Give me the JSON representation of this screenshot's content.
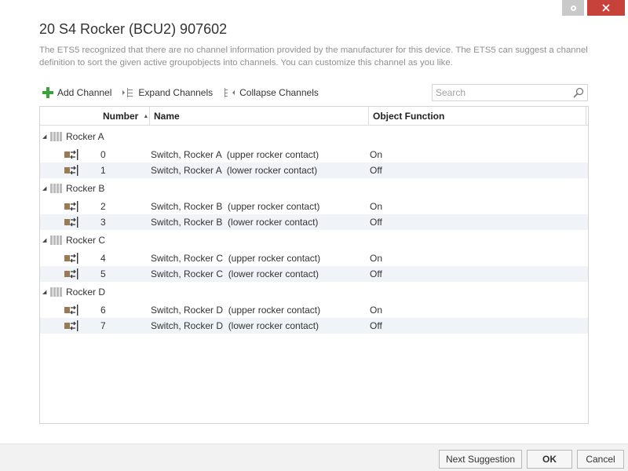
{
  "dialog": {
    "title": "20 S4 Rocker (BCU2)  907602",
    "description": "The ETS5 recognized that there are no channel information provided by the manufacturer for this device. The ETS5 can suggest a channel definition to sort the given active groupobjects into channels. You can customize this channel as you like."
  },
  "toolbar": {
    "add_channel": "Add Channel",
    "expand_channels": "Expand Channels",
    "collapse_channels": "Collapse Channels",
    "search_placeholder": "Search"
  },
  "grid": {
    "columns": {
      "number": "Number",
      "name": "Name",
      "object_function": "Object Function"
    },
    "groups": [
      {
        "label": "Rocker A",
        "rows": [
          {
            "number": "0",
            "name": "Switch, Rocker A  (upper rocker contact)",
            "function": "On"
          },
          {
            "number": "1",
            "name": "Switch, Rocker A  (lower rocker contact)",
            "function": "Off"
          }
        ]
      },
      {
        "label": "Rocker B",
        "rows": [
          {
            "number": "2",
            "name": "Switch, Rocker B  (upper rocker contact)",
            "function": "On"
          },
          {
            "number": "3",
            "name": "Switch, Rocker B  (lower rocker contact)",
            "function": "Off"
          }
        ]
      },
      {
        "label": "Rocker C",
        "rows": [
          {
            "number": "4",
            "name": "Switch, Rocker C  (upper rocker contact)",
            "function": "On"
          },
          {
            "number": "5",
            "name": "Switch, Rocker C  (lower rocker contact)",
            "function": "Off"
          }
        ]
      },
      {
        "label": "Rocker D",
        "rows": [
          {
            "number": "6",
            "name": "Switch, Rocker D  (upper rocker contact)",
            "function": "On"
          },
          {
            "number": "7",
            "name": "Switch, Rocker D  (lower rocker contact)",
            "function": "Off"
          }
        ]
      }
    ]
  },
  "footer": {
    "next_suggestion": "Next Suggestion",
    "ok": "OK",
    "cancel": "Cancel"
  },
  "icons": {
    "add": "plus-icon",
    "expand": "expand-tree-icon",
    "collapse": "collapse-tree-icon",
    "search": "magnifier-icon",
    "channel": "channel-icon",
    "group_object": "group-object-icon"
  },
  "colors": {
    "accent_green": "#3aa43a",
    "close_red": "#c8423c",
    "row_alt": "#f0f4f9",
    "object_icon_brown": "#9a7a52"
  }
}
